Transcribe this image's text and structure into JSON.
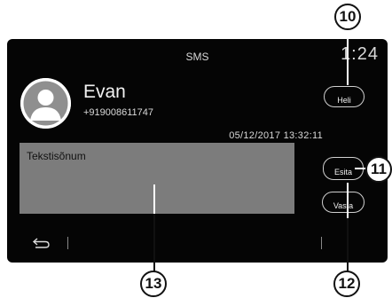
{
  "screen": {
    "title": "SMS",
    "clock": "1:24"
  },
  "contact": {
    "name": "Evan",
    "phone": "+919008611747"
  },
  "message": {
    "timestamp": "05/12/2017  13:32:11",
    "text": "Tekstisõnum"
  },
  "buttons": {
    "heli": "Heli",
    "esita": "Esita",
    "vasta": "Vasta"
  },
  "callouts": {
    "c10": "10",
    "c11": "11",
    "c12": "12",
    "c13": "13"
  },
  "icons": {
    "avatar": "person-avatar-icon",
    "back": "back-arrow-icon"
  }
}
